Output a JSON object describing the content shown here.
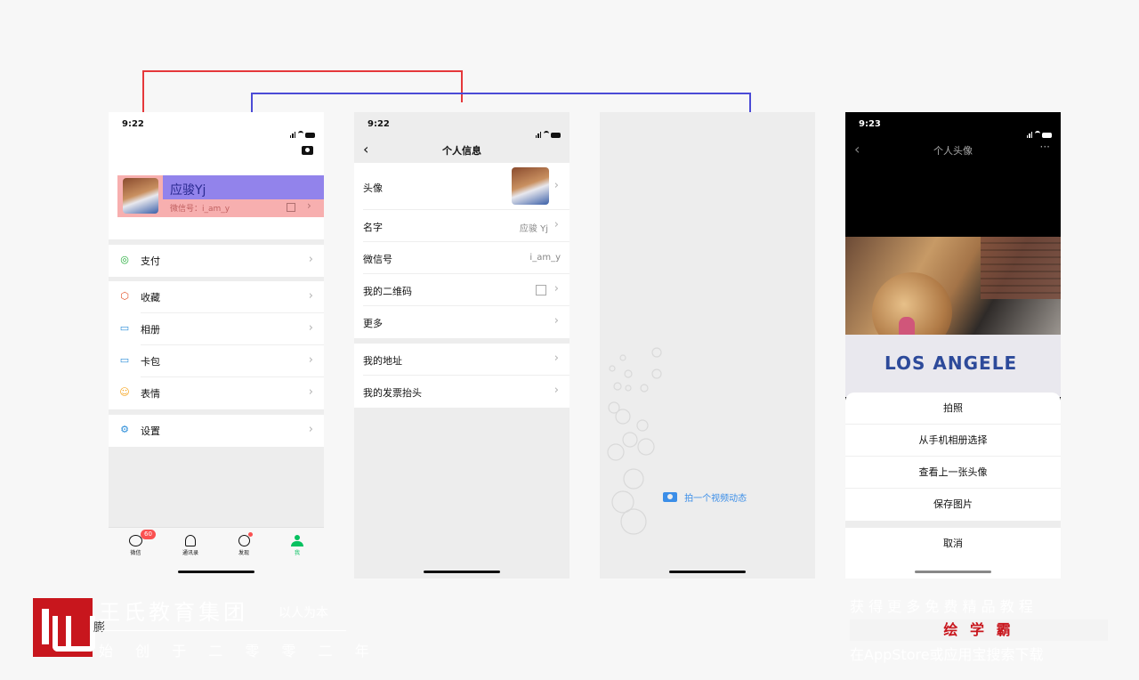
{
  "p1": {
    "time": "9:22",
    "name": "应骏Yj",
    "wechat_id": "微信号：i_am_y",
    "menu": [
      {
        "icon": "pay-icon",
        "glyph": "◎",
        "color": "#22ac38",
        "label": "支付"
      },
      {
        "icon": "favorites-icon",
        "glyph": "⬡",
        "color": "#e4532a",
        "label": "收藏"
      },
      {
        "icon": "album-icon",
        "glyph": "▭",
        "color": "#2a8cd8",
        "label": "相册"
      },
      {
        "icon": "card-icon",
        "glyph": "▭",
        "color": "#2a8cd8",
        "label": "卡包"
      },
      {
        "icon": "sticker-icon",
        "glyph": "☺",
        "color": "#f5a623",
        "label": "表情"
      },
      {
        "icon": "settings-icon",
        "glyph": "⚙",
        "color": "#2a8cd8",
        "label": "设置"
      }
    ],
    "tabs": [
      {
        "label": "微信",
        "badge": "60"
      },
      {
        "label": "通讯录"
      },
      {
        "label": "发现"
      },
      {
        "label": "我"
      }
    ]
  },
  "p2": {
    "time": "9:22",
    "title": "个人信息",
    "rows": [
      {
        "label": "头像",
        "value": ""
      },
      {
        "label": "名字",
        "value": "应骏 Yj"
      },
      {
        "label": "微信号",
        "value": "i_am_y"
      },
      {
        "label": "我的二维码",
        "value": ""
      },
      {
        "label": "更多",
        "value": ""
      }
    ],
    "rows2": [
      {
        "label": "我的地址"
      },
      {
        "label": "我的发票抬头"
      }
    ]
  },
  "p3": {
    "moment_label": "拍一个视频动态"
  },
  "p4": {
    "time": "9:23",
    "title": "个人头像",
    "more": "···",
    "photo_text": "LOS ANGELE",
    "sheet": [
      "拍照",
      "从手机相册选择",
      "查看上一张头像",
      "保存图片"
    ],
    "cancel": "取消"
  },
  "footer_left": {
    "brand": "王氏教育集团",
    "slogan": "以人为本",
    "founded": "始 创 于 二 零 零 二 年",
    "side": "膨"
  },
  "footer_right": {
    "line1": "获 得 更 多 免 费 精 品 教 程",
    "app": "绘 学 霸",
    "line3": "在AppStore或应用宝搜索下载"
  },
  "colors": {
    "red": "#e5383b",
    "blue": "#4b4bd6",
    "wechat_green": "#07c160",
    "link_blue": "#3b8ee8"
  }
}
